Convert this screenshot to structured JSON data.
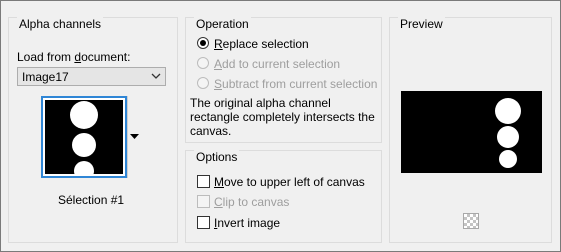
{
  "alpha_channels": {
    "title": "Alpha channels",
    "load_label": "Load from document:",
    "load_underline": "d",
    "document_value": "Image17",
    "selection_name": "Sélection #1"
  },
  "operation": {
    "title": "Operation",
    "options": [
      {
        "label": "Replace selection",
        "accel": "R",
        "selected": true,
        "enabled": true
      },
      {
        "label": "Add to current selection",
        "accel": "A",
        "selected": false,
        "enabled": false
      },
      {
        "label": "Subtract from current selection",
        "accel": "S",
        "selected": false,
        "enabled": false
      }
    ],
    "info": "The original alpha channel rectangle completely intersects the canvas."
  },
  "options": {
    "title": "Options",
    "checks": [
      {
        "label": "Move to upper left of canvas",
        "accel": "M",
        "checked": false,
        "enabled": true
      },
      {
        "label": "Clip to canvas",
        "accel": "C",
        "checked": false,
        "enabled": false
      },
      {
        "label": "Invert image",
        "accel": "I",
        "checked": false,
        "enabled": true
      }
    ]
  },
  "preview": {
    "title": "Preview"
  },
  "colors": {
    "thumb_border": "#2f86d6",
    "disabled_text": "#9e9e9e"
  },
  "icons": [
    "chevron-down-icon",
    "dropdown-arrow-icon",
    "transparency-checker-icon"
  ]
}
